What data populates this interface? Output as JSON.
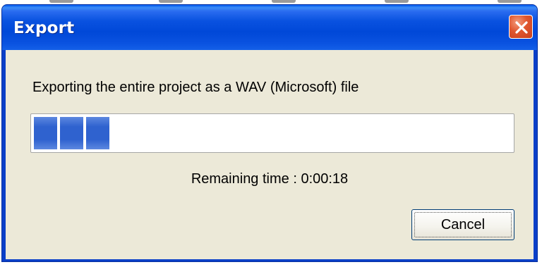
{
  "dialog": {
    "title": "Export",
    "close_icon": "close-icon",
    "message": "Exporting the entire project as a WAV (Microsoft) file",
    "progress_fraction": 0.16,
    "remaining_time": "Remaining time : 0:00:18",
    "cancel_label": "Cancel"
  },
  "colors": {
    "titlebar": "#0a52e0",
    "close_button": "#e0562e",
    "client_background": "#ece9d8",
    "progress_block": "#2f62cf"
  }
}
